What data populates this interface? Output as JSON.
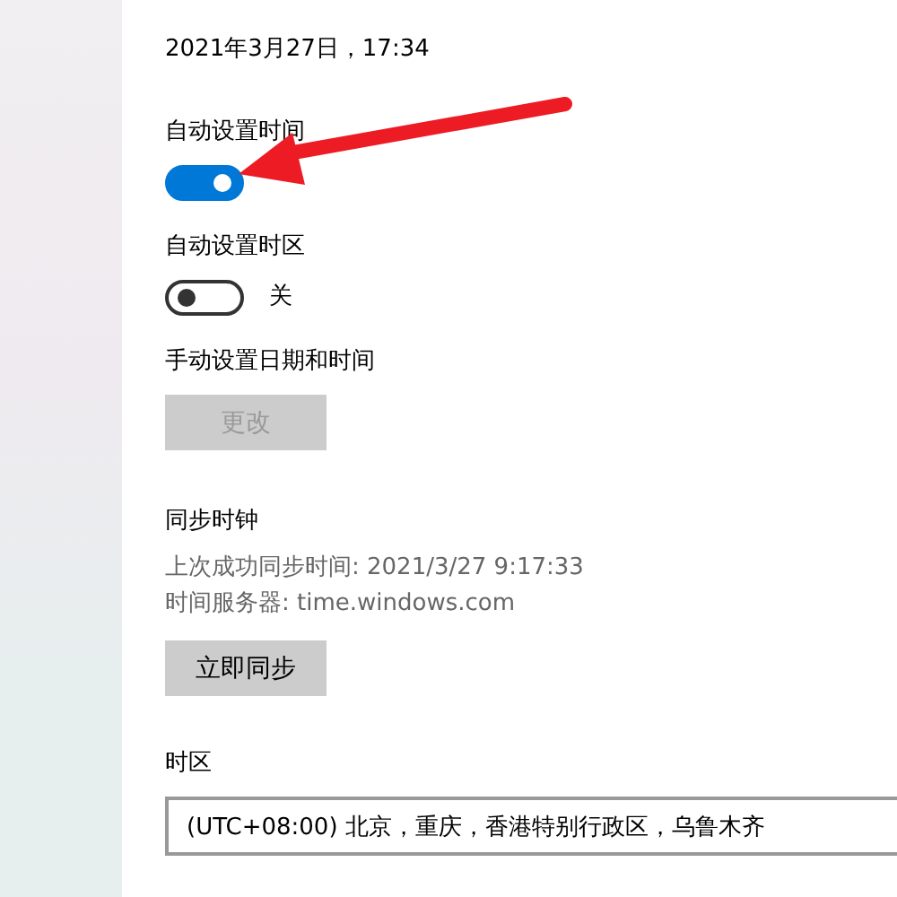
{
  "current_datetime": "2021年3月27日，17:34",
  "settings": [
    {
      "kind": "toggle",
      "label": "自动设置时间",
      "on": true
    },
    {
      "kind": "toggle",
      "label": "自动设置时区",
      "on": false,
      "state_text": "关"
    },
    {
      "kind": "button",
      "label": "手动设置日期和时间",
      "button": "更改",
      "disabled": true
    }
  ],
  "sync": {
    "title": "同步时钟",
    "lines": [
      "上次成功同步时间: 2021/3/27 9:17:33",
      "时间服务器: time.windows.com"
    ],
    "button": "立即同步",
    "disabled": false
  },
  "timezone": {
    "label": "时区",
    "value": "(UTC+08:00) 北京，重庆，香港特别行政区，乌鲁木齐"
  }
}
